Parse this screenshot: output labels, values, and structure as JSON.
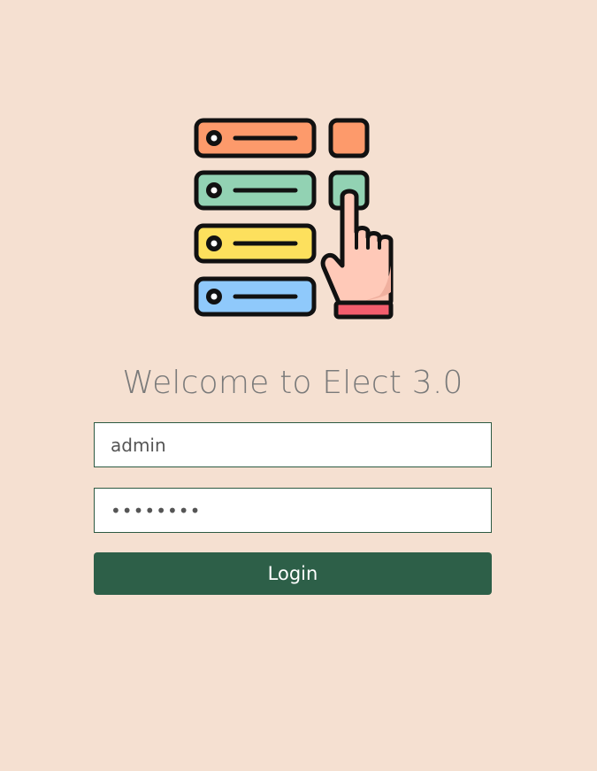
{
  "page": {
    "title": "Welcome to Elect 3.0"
  },
  "form": {
    "username_value": "admin",
    "password_value": "********",
    "login_label": "Login"
  },
  "colors": {
    "background": "#f5e0d1",
    "button": "#2d5f48",
    "field_border": "#2d5a42",
    "row_orange": "#fd9a6b",
    "row_green": "#92d2b3",
    "row_yellow": "#fde05d",
    "row_blue": "#8fc9fb",
    "hand": "#ffc9b8",
    "cuff": "#f35d6d"
  },
  "icons": {
    "logo": "voting-list-hand-icon"
  }
}
